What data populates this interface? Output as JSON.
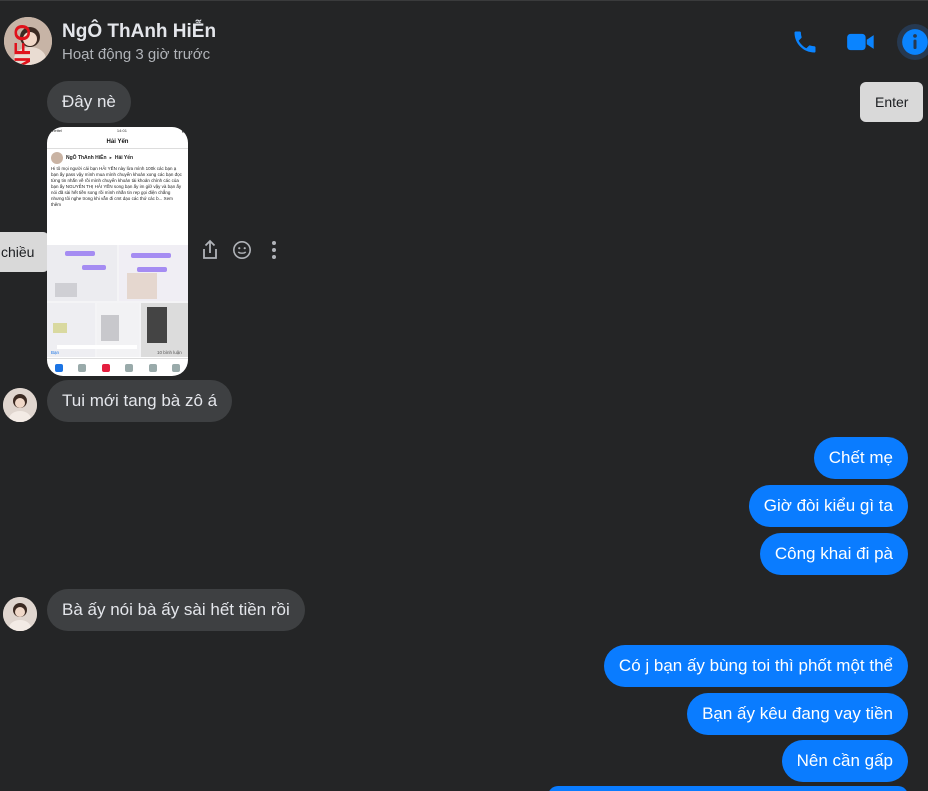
{
  "header": {
    "avatar_tag": "NFO",
    "contact_name": "NgÔ ThAnh HiỄn",
    "status": "Hoạt động 3 giờ trước",
    "icons": [
      "phone-icon",
      "video-camera-icon",
      "info-icon"
    ]
  },
  "tooltips": {
    "enter": "Enter",
    "left_partial": "chiều"
  },
  "messages": [
    {
      "id": "m1",
      "direction": "in",
      "text": "Đây nè"
    },
    {
      "id": "m2",
      "direction": "in",
      "text": "Tui mới tang bà zô á"
    },
    {
      "id": "m3",
      "direction": "out",
      "text": "Chết mẹ"
    },
    {
      "id": "m4",
      "direction": "out",
      "text": "Giờ đòi kiểu gì ta"
    },
    {
      "id": "m5",
      "direction": "out",
      "text": "Công khai đi pà"
    },
    {
      "id": "m6",
      "direction": "in",
      "text": "Bà ấy nói bà ấy sài hết tiền rồi"
    },
    {
      "id": "m7",
      "direction": "out",
      "text": "Có j bạn ấy bùng toi thì phốt một thể"
    },
    {
      "id": "m8",
      "direction": "out",
      "text": "Bạn ấy kêu đang vay tiền"
    },
    {
      "id": "m9",
      "direction": "out",
      "text": "Nên cần gấp"
    }
  ],
  "attachment": {
    "status_left": "Viettel",
    "status_time": "14:01",
    "title": "Hải Yến",
    "author": "NgÔ ThAnh HiỄn",
    "recipient": "Hải Yến",
    "post_text": "Hi tô mọi người cái bạn HẢI YẾN này lừa mình 100k các bạn ạ bạn ấy pass vậy mình mua mình chuyển khoản xong các bạn đọc từng tin nhắn về rồi mình chuyển khoản tài khoản chính các của bạn ấy NGUYỄN THỊ HẢI YẾN song bạn ấy im giữ vậy và bạn ấy nói đã sài hết tiền song rồi mình nhắn tin rep gọi điện chẳng nhưng tôi nghe trong khi vẫn đi cmt dạo các thứ các b... Xem thêm",
    "comment_label": "Bạn",
    "comment_count": "10 bình luận"
  },
  "actions": [
    "share-icon",
    "emoji-icon",
    "more-icon"
  ]
}
